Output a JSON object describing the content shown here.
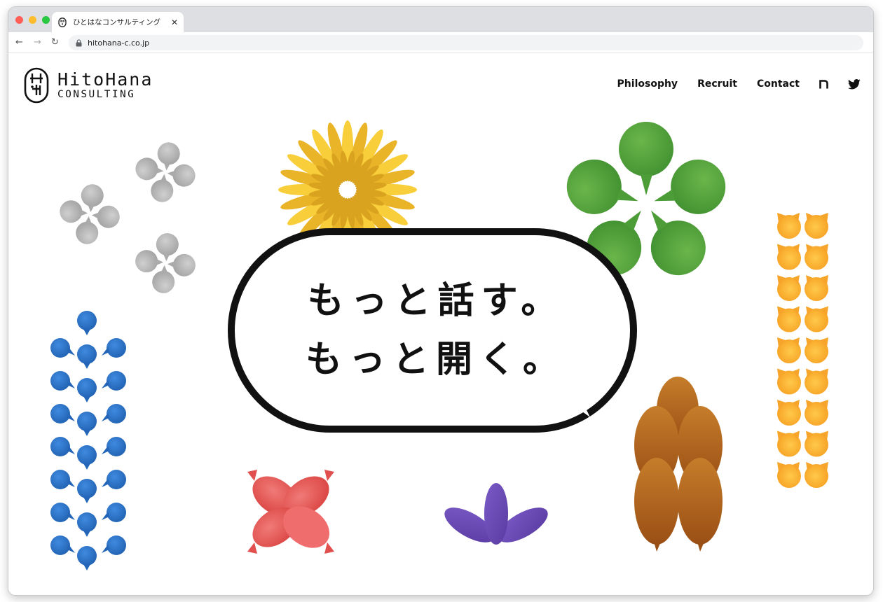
{
  "browser": {
    "tab_title": "ひとはなコンサルティング",
    "tab_close": "✕",
    "url": "hitohana-c.co.jp",
    "back": "←",
    "forward": "→",
    "reload": "↻",
    "traffic_light_colors": [
      "#ff5f57",
      "#febc2e",
      "#28c840"
    ]
  },
  "header": {
    "logo_line1": "HitoHana",
    "logo_line2": "CONSULTING",
    "nav": [
      "Philosophy",
      "Recruit",
      "Contact"
    ],
    "social_icons": [
      "note-icon",
      "twitter-icon"
    ]
  },
  "hero": {
    "line1": "もっと話す。",
    "line2": "もっと開く。"
  },
  "colors": {
    "gray_flower": "#b0b0b0",
    "yellow_flower": "#f6c935",
    "green_flower": "#5aa63e",
    "blue_bubbles": "#2f76c9",
    "orange_cats": "#fbb032",
    "red_flower": "#e8575b",
    "purple_leaves": "#6a4ab5",
    "brown_pods": "#b7661f"
  }
}
